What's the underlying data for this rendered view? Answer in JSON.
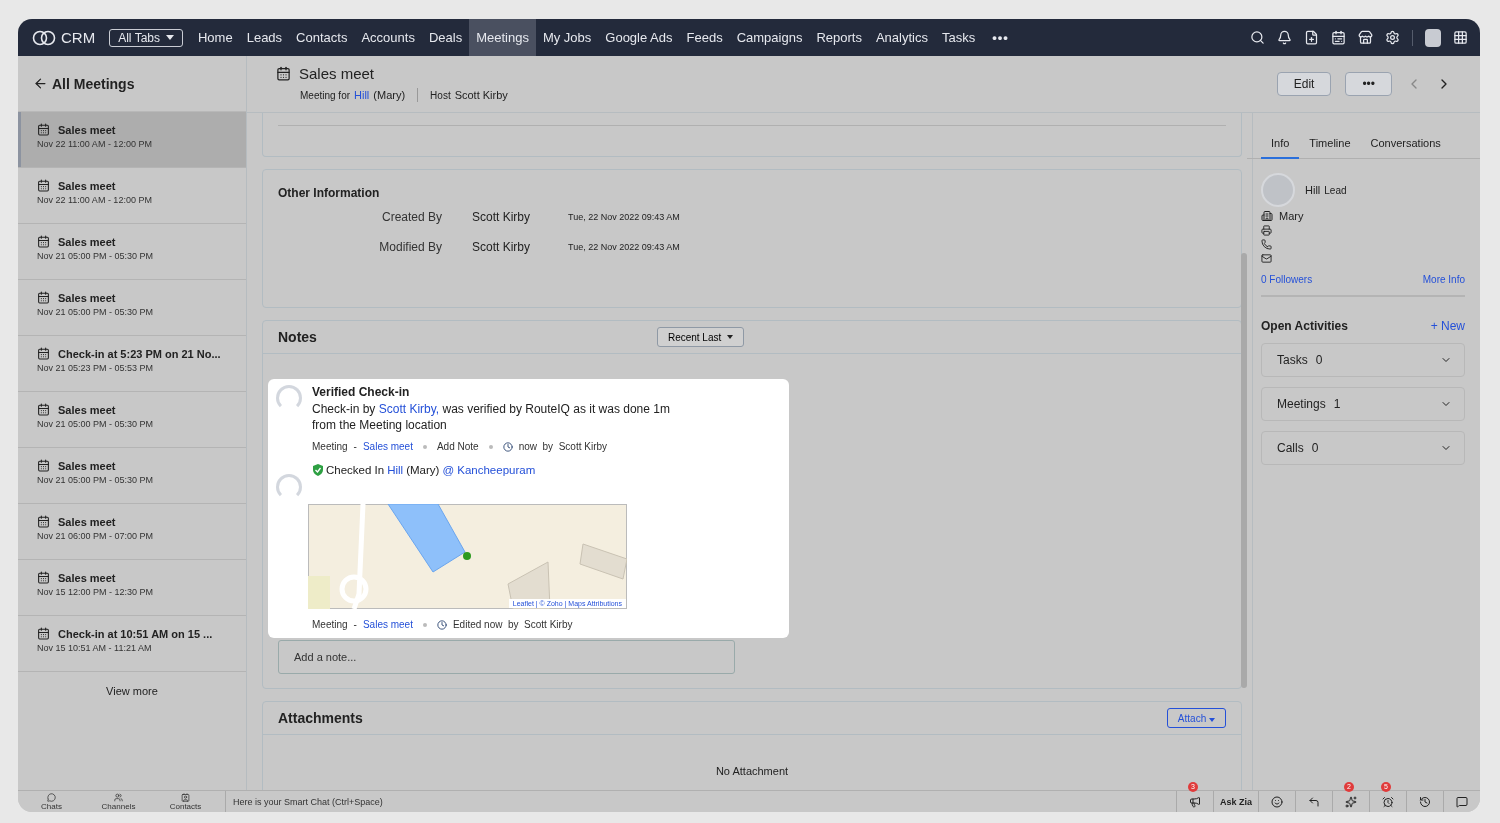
{
  "nav": {
    "logo": "CRM",
    "all_tabs": "All Tabs",
    "more": "•••",
    "tabs": [
      {
        "label": "Home",
        "selected": false
      },
      {
        "label": "Leads",
        "selected": false
      },
      {
        "label": "Contacts",
        "selected": false
      },
      {
        "label": "Accounts",
        "selected": false
      },
      {
        "label": "Deals",
        "selected": false
      },
      {
        "label": "Meetings",
        "selected": true
      },
      {
        "label": "My Jobs",
        "selected": false
      },
      {
        "label": "Google Ads",
        "selected": false
      },
      {
        "label": "Feeds",
        "selected": false
      },
      {
        "label": "Campaigns",
        "selected": false
      },
      {
        "label": "Reports",
        "selected": false
      },
      {
        "label": "Analytics",
        "selected": false
      },
      {
        "label": "Tasks",
        "selected": false
      }
    ]
  },
  "sidebar": {
    "back": "All Meetings",
    "view_more": "View more",
    "items": [
      {
        "title": "Sales meet",
        "time": "Nov 22 11:00 AM - 12:00 PM",
        "selected": true
      },
      {
        "title": "Sales meet",
        "time": "Nov 22 11:00 AM - 12:00 PM",
        "selected": false
      },
      {
        "title": "Sales meet",
        "time": "Nov 21 05:00 PM - 05:30 PM",
        "selected": false
      },
      {
        "title": "Sales meet",
        "time": "Nov 21 05:00 PM - 05:30 PM",
        "selected": false
      },
      {
        "title": "Check-in at 5:23 PM on 21 No...",
        "time": "Nov 21 05:23 PM - 05:53 PM",
        "selected": false
      },
      {
        "title": "Sales meet",
        "time": "Nov 21 05:00 PM - 05:30 PM",
        "selected": false
      },
      {
        "title": "Sales meet",
        "time": "Nov 21 05:00 PM - 05:30 PM",
        "selected": false
      },
      {
        "title": "Sales meet",
        "time": "Nov 21 06:00 PM - 07:00 PM",
        "selected": false
      },
      {
        "title": "Sales meet",
        "time": "Nov 15 12:00 PM - 12:30 PM",
        "selected": false
      },
      {
        "title": "Check-in at 10:51 AM on 15 ...",
        "time": "Nov 15 10:51 AM - 11:21 AM",
        "selected": false
      }
    ]
  },
  "record": {
    "title": "Sales meet",
    "for_label": "Meeting for",
    "lead": "Hill",
    "lead_company": "(Mary)",
    "host_label": "Host",
    "host": "Scott Kirby",
    "edit": "Edit",
    "more": "•••"
  },
  "other_info": {
    "title": "Other Information",
    "rows": [
      {
        "label": "Created By",
        "user": "Scott Kirby",
        "date": "Tue, 22 Nov 2022 09:43 AM"
      },
      {
        "label": "Modified By",
        "user": "Scott Kirby",
        "date": "Tue, 22 Nov 2022 09:43 AM"
      }
    ]
  },
  "notes": {
    "title": "Notes",
    "sort": "Recent Last",
    "placeholder": "Add a note...",
    "note": {
      "title": "Verified Check-in",
      "body_before": "Check-in by",
      "body_link": "Scott Kirby,",
      "body_after": "was verified by RouteIQ as it was done 1m from the Meeting location",
      "meta_module": "Meeting",
      "meta_sep": "-",
      "meta_record": "Sales meet",
      "meta_action": "Add Note",
      "meta_time": "now  by  Scott Kirby",
      "checkin_label": "Checked In",
      "checkin_lead": "Hill",
      "checkin_company": "(Mary)",
      "checkin_location": "@ Kancheepuram",
      "map_attribution": "Leaflet | © Zoho | Maps Attributions",
      "footer_module": "Meeting",
      "footer_sep": "-",
      "footer_record": "Sales meet",
      "footer_time": "Edited now  by  Scott Kirby"
    }
  },
  "attachments": {
    "title": "Attachments",
    "attach": "Attach",
    "empty": "No Attachment"
  },
  "panel": {
    "tabs": [
      {
        "label": "Info",
        "selected": true
      },
      {
        "label": "Timeline",
        "selected": false
      },
      {
        "label": "Conversations",
        "selected": false
      }
    ],
    "name": "Hill",
    "tag": "Lead",
    "company": "Mary",
    "followers": "0 Followers",
    "more_info": "More Info",
    "activities_title": "Open Activities",
    "new": "+ New",
    "activities": [
      {
        "label": "Tasks",
        "count": "0"
      },
      {
        "label": "Meetings",
        "count": "1"
      },
      {
        "label": "Calls",
        "count": "0"
      }
    ]
  },
  "bottom_bar": {
    "apps": [
      {
        "label": "Chats"
      },
      {
        "label": "Channels"
      },
      {
        "label": "Contacts"
      }
    ],
    "smart_chat": "Here is your Smart Chat (Ctrl+Space)",
    "tools": [
      {
        "kind": "icon",
        "badge": "3"
      },
      {
        "kind": "text",
        "label": "Ask Zia"
      },
      {
        "kind": "icon"
      },
      {
        "kind": "icon"
      },
      {
        "kind": "icon",
        "badge": "2"
      },
      {
        "kind": "icon",
        "badge": "5"
      },
      {
        "kind": "icon"
      },
      {
        "kind": "icon"
      }
    ]
  }
}
